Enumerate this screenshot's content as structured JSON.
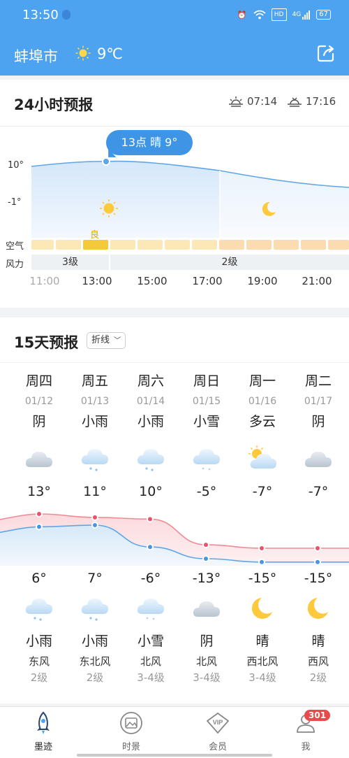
{
  "status": {
    "time": "13:50",
    "hd": "HD",
    "network": "4G",
    "battery": "67"
  },
  "header": {
    "city": "蚌埠市",
    "temp": "9℃"
  },
  "hourly": {
    "title": "24小时预报",
    "sunrise": "07:14",
    "sunset": "17:16",
    "tooltip": "13点 晴 9°",
    "y_labels": [
      "10°",
      "-1°"
    ],
    "air_label": "空气",
    "air_quality_text": "良",
    "wind_label": "风力",
    "wind_segments": [
      "3级",
      "2级"
    ],
    "times": [
      "11:00",
      "13:00",
      "15:00",
      "17:00",
      "19:00",
      "21:00"
    ]
  },
  "daily": {
    "title": "15天预报",
    "mode": "折线",
    "days": [
      {
        "week": "周四",
        "date": "01/12",
        "day_wx": "阴",
        "hi": "13°",
        "lo": "6°",
        "night_wx": "小雨",
        "wind": "东风",
        "level": "2级",
        "day_icon": "cloud-icon",
        "night_icon": "rain-icon"
      },
      {
        "week": "周五",
        "date": "01/13",
        "day_wx": "小雨",
        "hi": "11°",
        "lo": "7°",
        "night_wx": "小雨",
        "wind": "东北风",
        "level": "2级",
        "day_icon": "rain-icon",
        "night_icon": "rain-icon"
      },
      {
        "week": "周六",
        "date": "01/14",
        "day_wx": "小雨",
        "hi": "10°",
        "lo": "-6°",
        "night_wx": "小雪",
        "wind": "北风",
        "level": "3-4级",
        "day_icon": "rain-icon",
        "night_icon": "snow-icon"
      },
      {
        "week": "周日",
        "date": "01/15",
        "day_wx": "小雪",
        "hi": "-5°",
        "lo": "-13°",
        "night_wx": "阴",
        "wind": "北风",
        "level": "3-4级",
        "day_icon": "snow-icon",
        "night_icon": "cloud-icon"
      },
      {
        "week": "周一",
        "date": "01/16",
        "day_wx": "多云",
        "hi": "-7°",
        "lo": "-15°",
        "night_wx": "晴",
        "wind": "西北风",
        "level": "3-4级",
        "day_icon": "partly-cloudy-icon",
        "night_icon": "moon-icon"
      },
      {
        "week": "周二",
        "date": "01/17",
        "day_wx": "阴",
        "hi": "-7°",
        "lo": "-15°",
        "night_wx": "晴",
        "wind": "西风",
        "level": "2级",
        "day_icon": "cloud-icon",
        "night_icon": "moon-icon"
      }
    ],
    "hi_values": [
      13,
      11,
      10,
      -5,
      -7,
      -7
    ],
    "lo_values": [
      6,
      7,
      -6,
      -13,
      -15,
      -15
    ]
  },
  "nav": {
    "items": [
      "墨迹",
      "时景",
      "会员",
      "我"
    ],
    "badge": "301"
  },
  "colors": {
    "accent": "#4da3ef",
    "hi_line": "#f08a94",
    "lo_line": "#5fa6e6",
    "aqi_good": "#f4c93a"
  }
}
